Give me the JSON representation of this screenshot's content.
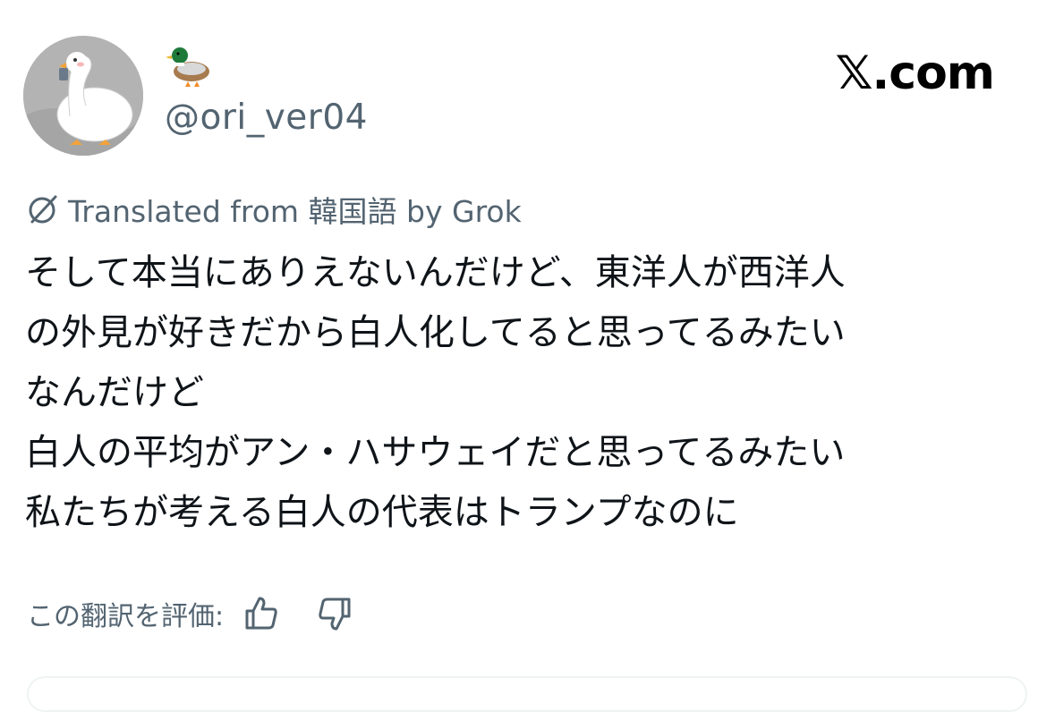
{
  "author": {
    "name_emoji": "🦆",
    "handle": "@ori_ver04",
    "avatar_icon": "white-goose-avatar"
  },
  "brand": {
    "label": "𝕏.com"
  },
  "translation": {
    "icon": "grok-icon",
    "label": "Translated from 韓国語 by Grok"
  },
  "tweet": {
    "lines": [
      "そして本当にありえないんだけど、東洋人が西洋人",
      "の外見が好きだから白人化してると思ってるみたい",
      "なんだけど",
      "白人の平均がアン・ハサウェイだと思ってるみたい",
      "私たちが考える白人の代表はトランプなのに"
    ]
  },
  "rating": {
    "label": "この翻訳を評価:",
    "thumbs_up_icon": "thumbs-up-icon",
    "thumbs_down_icon": "thumbs-down-icon"
  },
  "colors": {
    "text": "#0f1419",
    "secondary": "#536471",
    "border": "#eff3f4"
  }
}
